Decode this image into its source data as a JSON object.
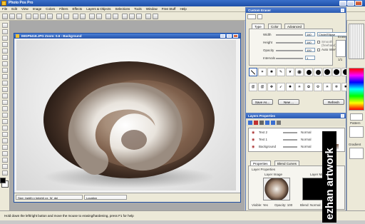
{
  "app": {
    "title": "Photo Pos Pro"
  },
  "menu": [
    "File",
    "Edit",
    "View",
    "Image",
    "Colors",
    "Filters",
    "Effects",
    "Layers & Objects",
    "Selections",
    "Tools",
    "Window",
    "Free Stuff",
    "Help"
  ],
  "image_window": {
    "title": "IMGP5418.JPG  Zoom: 0.6 - Background",
    "status": [
      "Size: (width x height) px_W_dpi",
      "Location"
    ]
  },
  "status_bar": {
    "text": "Hold down the left/right button and move the mouse to erasing/hardening, press F1 for help"
  },
  "custom_eraser": {
    "title": "Custom Eraser",
    "tabs": [
      "Type",
      "Color",
      "Advanced"
    ],
    "rows": [
      {
        "label": "Width",
        "value": "140",
        "select": "Circle/Ellipse"
      },
      {
        "label": "Height",
        "value": "140",
        "check": "Smooth (freehand)"
      },
      {
        "label": "Opacity",
        "value": "100",
        "check": "Auto Intervals"
      },
      {
        "label": "Intervals",
        "value": "1"
      }
    ],
    "eraser_label": "Eraser",
    "eraser_value": "1/1",
    "buttons": [
      "Save As...",
      "New ...",
      "Refresh"
    ]
  },
  "layers": {
    "title": "Layers Properties",
    "items": [
      {
        "name": "Text 2",
        "blend": "Normal"
      },
      {
        "name": "Text 1",
        "blend": "Normal"
      },
      {
        "name": "Background",
        "blend": "Normal"
      }
    ],
    "tabs": [
      "Properties",
      "Blend Curves"
    ],
    "props_title": "Layer Properties",
    "layer_image_label": "Layer Image",
    "layer_mask_label": "Layer Mask",
    "props_row": [
      "Visible: Yes",
      "Opacity: 100",
      "Blend: Normal"
    ]
  },
  "right_side": {
    "pattern_label": "Pattern",
    "gradient_label": "Gradient"
  },
  "watermark": {
    "text": "ezhan artwork"
  },
  "colors": {
    "accent": "#2b5ab0",
    "panel": "#ece9d8",
    "title_text": "#ffffff"
  }
}
